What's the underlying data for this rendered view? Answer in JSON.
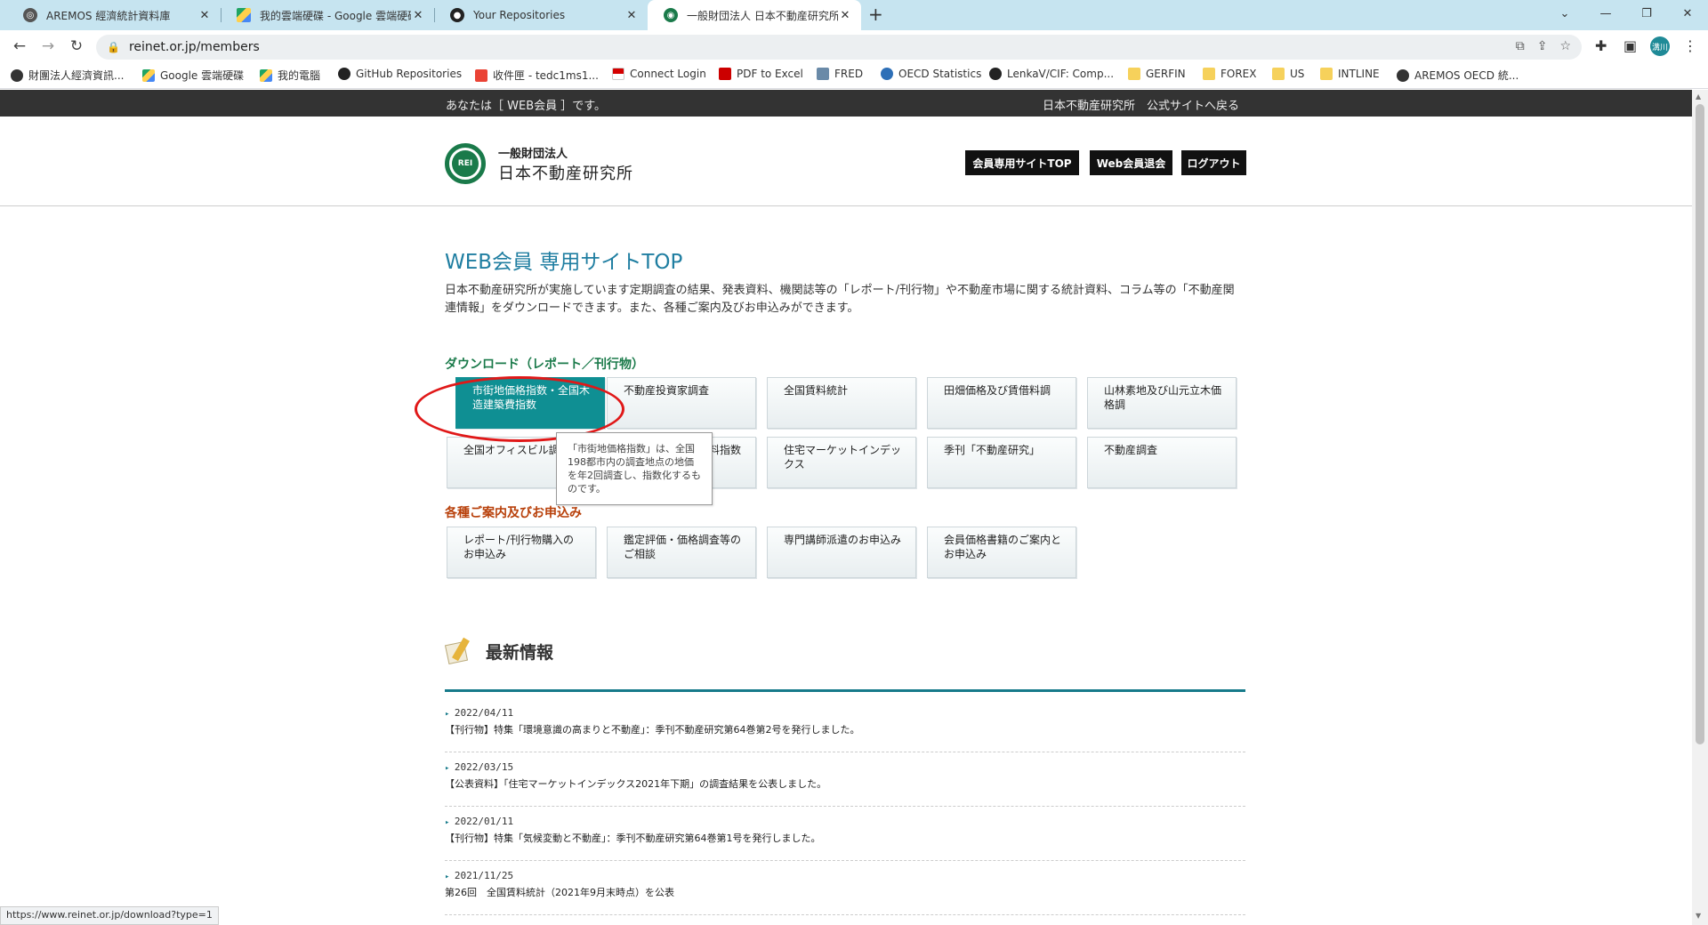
{
  "browser": {
    "tabs": [
      {
        "label": "AREMOS 經濟統計資料庫",
        "active": false
      },
      {
        "label": "我的雲端硬碟 - Google 雲端硬碟",
        "active": false
      },
      {
        "label": "Your Repositories",
        "active": false
      },
      {
        "label": "一般財団法人 日本不動産研究所",
        "active": true
      }
    ],
    "url": "reinet.or.jp/members",
    "profile_label": "溝川",
    "bookmarks": [
      "財團法人經濟資訊...",
      "Google 雲端硬碟",
      "我的電腦",
      "GitHub Repositories",
      "收件匣 - tedc1ms1...",
      "Connect Login",
      "PDF to Excel",
      "FRED",
      "OECD Statistics",
      "LenkaV/CIF: Comp...",
      "GERFIN",
      "FOREX",
      "US",
      "INTLINE",
      "AREMOS OECD 統..."
    ]
  },
  "member_bar": {
    "left": "あなたは［ WEB会員 ］です。",
    "right": "日本不動産研究所　公式サイトへ戻る"
  },
  "logo": {
    "mark": "REI",
    "sub": "一般財団法人",
    "main": "日本不動産研究所"
  },
  "header_buttons": {
    "members_top": "会員専用サイトTOP",
    "withdraw": "Web会員退会",
    "logout": "ログアウト"
  },
  "page_title": "WEB会員 専用サイトTOP",
  "intro": "日本不動産研究所が実施しています定期調査の結果、発表資料、機関誌等の「レポート/刊行物」や不動産市場に関する統計資料、コラム等の「不動産関連情報」をダウンロードできます。また、各種ご案内及びお申込みができます。",
  "download_section": {
    "title": "ダウンロード（レポート／刊行物）",
    "row1": [
      "市街地価格指数・全国木造建築費指数",
      "不動産投資家調査",
      "全国賃料統計",
      "田畑価格及び賃借料調",
      "山林素地及び山元立木価格調"
    ],
    "row2": [
      "全国オフィスビル調査",
      "国際不動産価格賃料指数のオフィス",
      "住宅マーケットインデックス",
      "季刊「不動産研究」",
      "不動産調査"
    ]
  },
  "tooltip": "「市街地価格指数」は、全国198都市内の調査地点の地価を年2回調査し、指数化するものです。",
  "guide_section": {
    "title": "各種ご案内及びお申込み",
    "items": [
      "レポート/刊行物購入のお申込み",
      "鑑定評価・価格調査等のご相談",
      "専門講師派遣のお申込み",
      "会員価格書籍のご案内とお申込み"
    ]
  },
  "news": {
    "title": "最新情報",
    "items": [
      {
        "date": "2022/04/11",
        "text": "【刊行物】特集「環境意識の高まりと不動産」：季刊不動産研究第64巻第2号を発行しました。"
      },
      {
        "date": "2022/03/15",
        "text": "【公表資料】「住宅マーケットインデックス2021年下期」の調査結果を公表しました。"
      },
      {
        "date": "2022/01/11",
        "text": "【刊行物】特集「気候変動と不動産」：季刊不動産研究第64巻第1号を発行しました。"
      },
      {
        "date": "2021/11/25",
        "text": "第26回　全国賃料統計（2021年9月末時点）を公表"
      }
    ]
  },
  "status_url": "https://www.reinet.or.jp/download?type=1",
  "colors": {
    "accent": "#1f7ea1",
    "active_card": "#0f8f93",
    "download_title": "#1a7a4a",
    "guide_title": "#b8400a",
    "highlight": "#e01818"
  }
}
